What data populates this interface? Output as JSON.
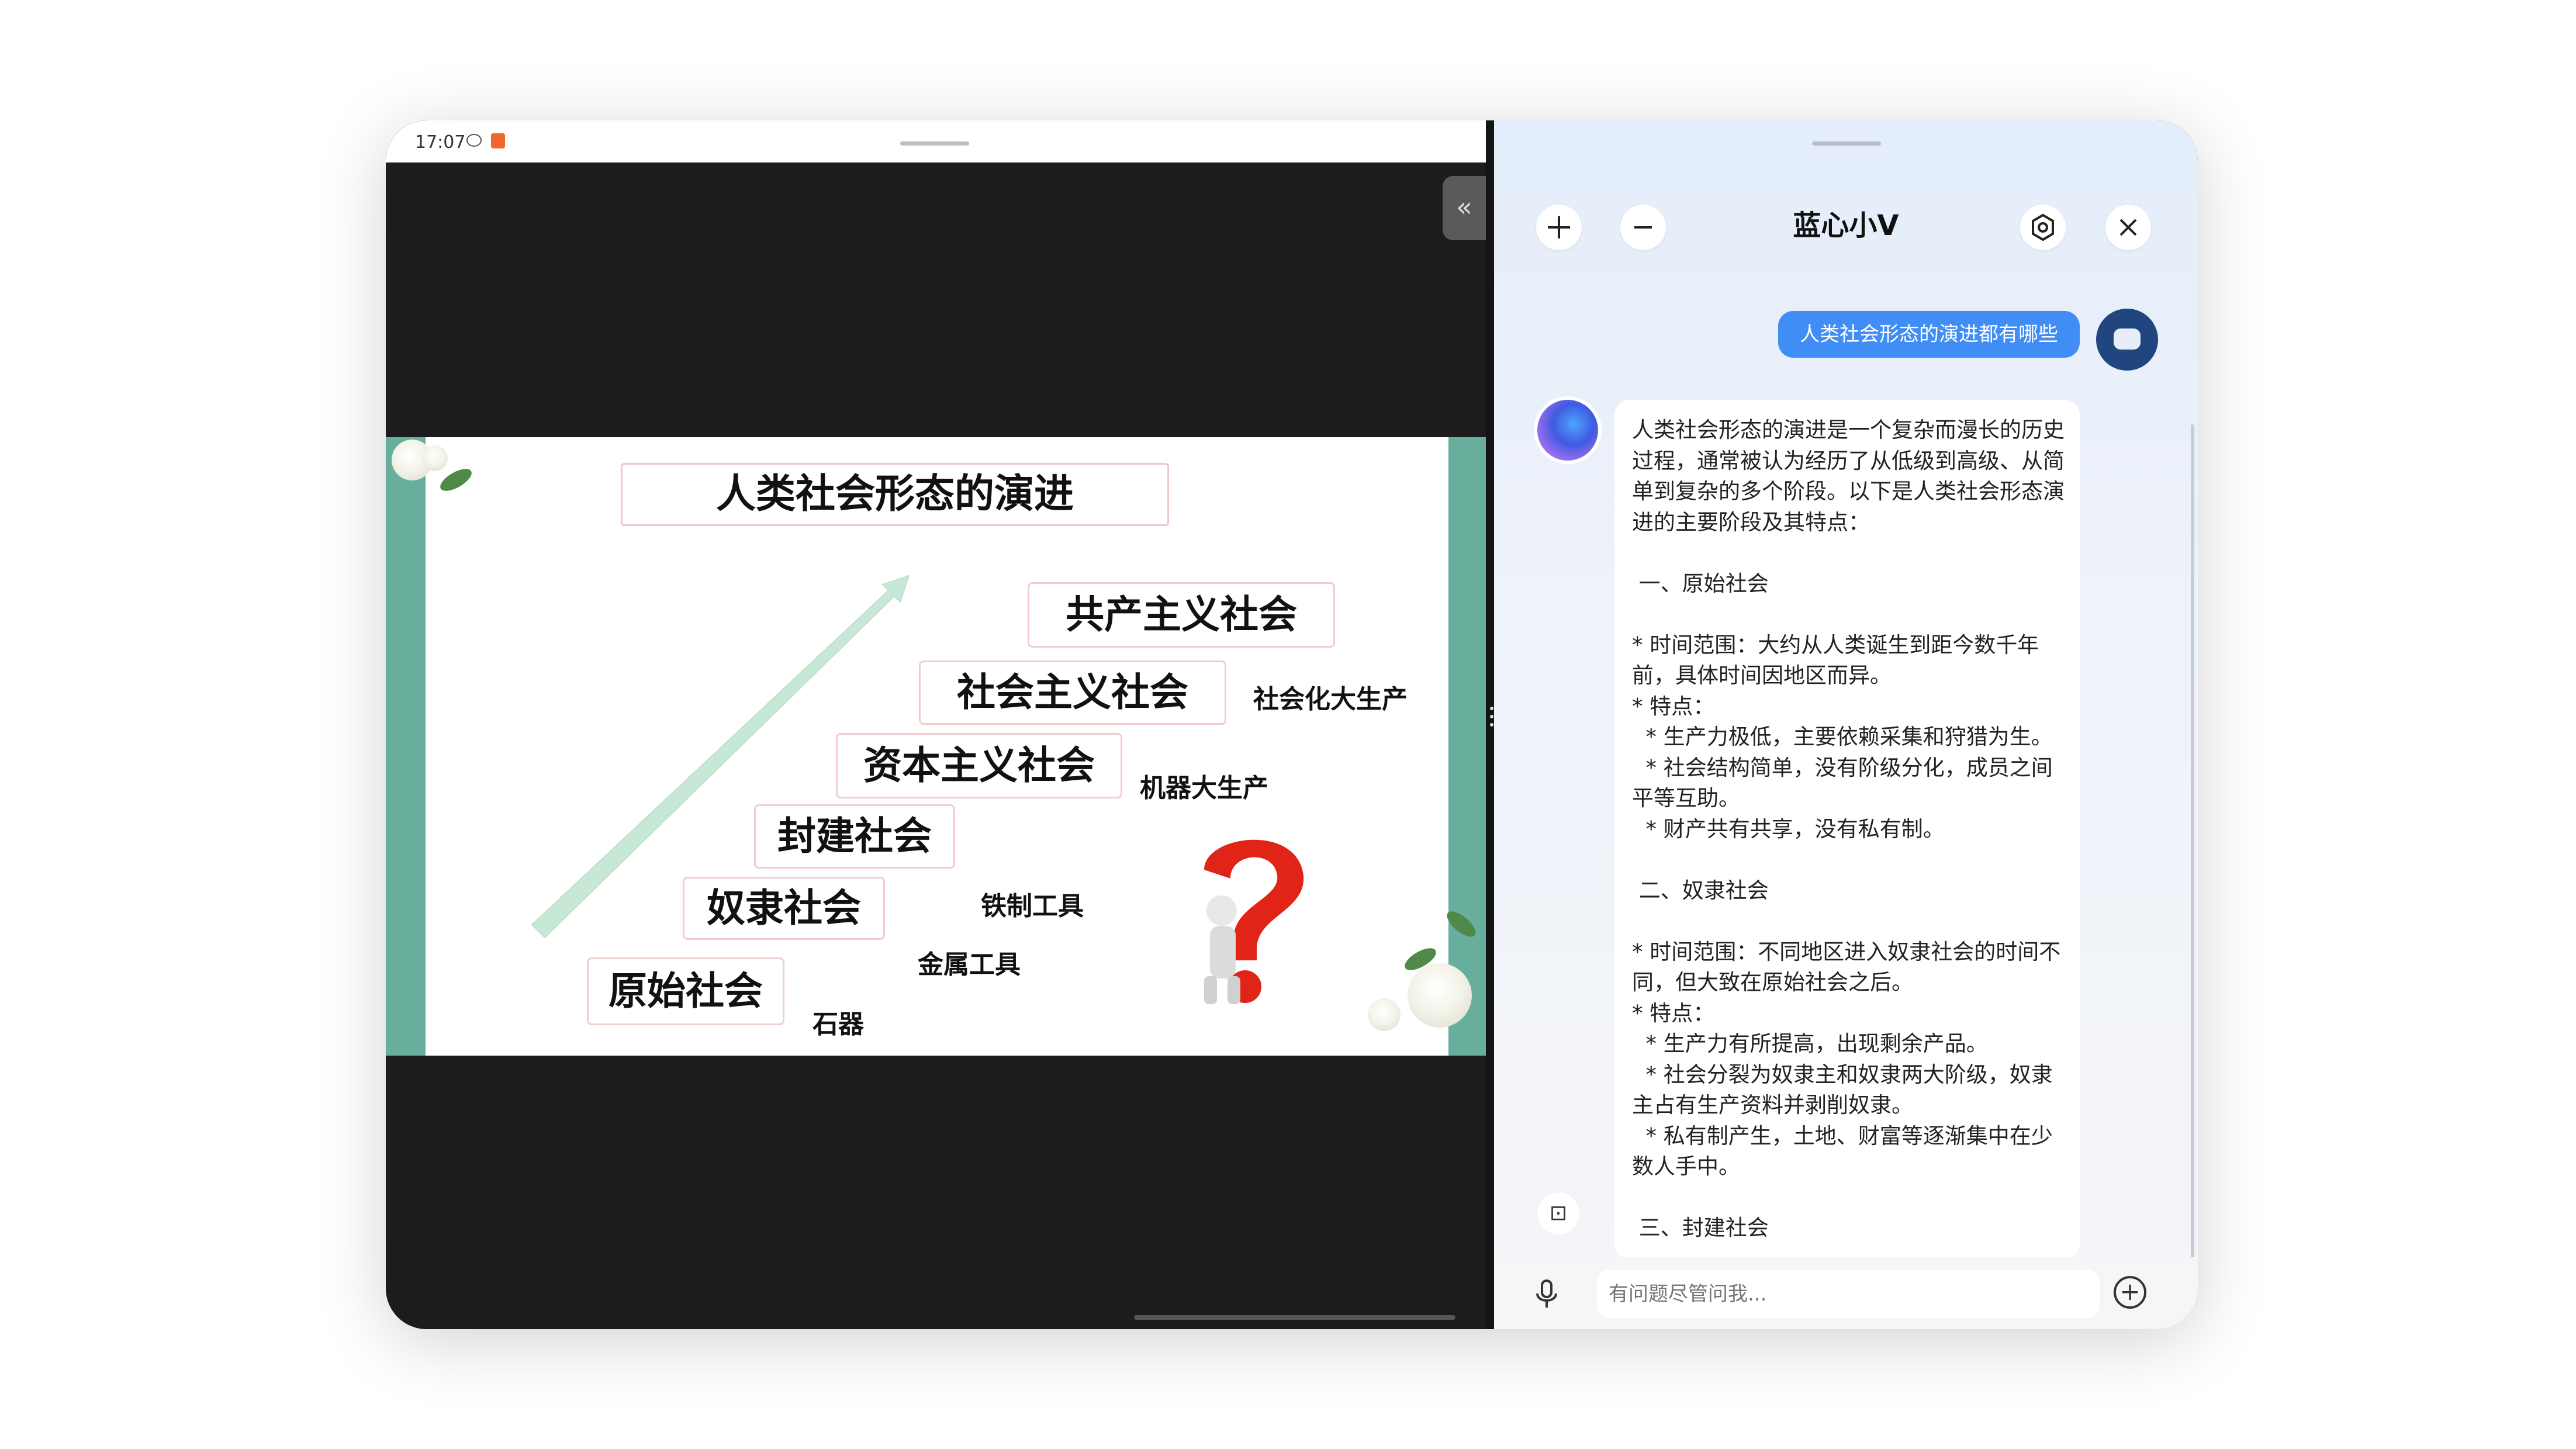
{
  "status_bar": {
    "time": "17:07"
  },
  "slide": {
    "title": "人类社会形态的演进",
    "stages": [
      "原始社会",
      "奴隶社会",
      "封建社会",
      "资本主义社会",
      "社会主义社会",
      "共产主义社会"
    ],
    "tools": [
      "石器",
      "金属工具",
      "铁制工具",
      "机器大生产",
      "社会化大生产"
    ]
  },
  "assistant": {
    "title": "蓝心小V",
    "user_question": "人类社会形态的演进都有哪些",
    "answer": "人类社会形态的演进是一个复杂而漫长的历史过程，通常被认为经历了从低级到高级、从简单到复杂的多个阶段。以下是人类社会形态演进的主要阶段及其特点：\n\n 一、原始社会\n\n* 时间范围：大约从人类诞生到距今数千年前，具体时间因地区而异。\n* 特点：\n  * 生产力极低，主要依赖采集和狩猎为生。\n  * 社会结构简单，没有阶级分化，成员之间平等互助。\n  * 财产共有共享，没有私有制。\n\n 二、奴隶社会\n\n* 时间范围：不同地区进入奴隶社会的时间不同，但大致在原始社会之后。\n* 特点：\n  * 生产力有所提高，出现剩余产品。\n  * 社会分裂为奴隶主和奴隶两大阶级，奴隶主占有生产资料并剥削奴隶。\n  * 私有制产生，土地、财富等逐渐集中在少数人手中。\n\n 三、封建社会",
    "input_placeholder": "有问题尽管问我..."
  }
}
